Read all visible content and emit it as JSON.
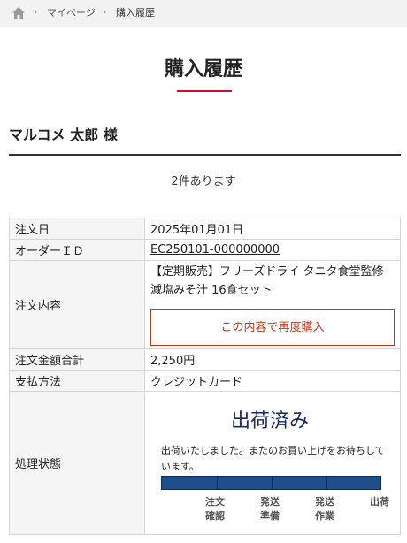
{
  "breadcrumb": {
    "home_icon": "home-icon",
    "separator_icon": "chevron-right-icon",
    "mypage": "マイページ",
    "current": "購入履歴"
  },
  "page": {
    "title": "購入履歴",
    "accent_color": "#c8102e"
  },
  "customer": {
    "name": "マルコメ 太郎 様"
  },
  "result": {
    "count_text": "2件あります"
  },
  "order": {
    "date_label": "注文日",
    "date_value": "2025年01月01日",
    "id_label": "オーダーＩＤ",
    "id_value": "EC250101-000000000",
    "content_label": "注文内容",
    "content_value": "【定期販売】フリーズドライ タニタ食堂監修減塩みそ汁 16食セット",
    "reorder_button": "この内容で再度購入",
    "total_label": "注文金額合計",
    "total_value": "2,250円",
    "payment_label": "支払方法",
    "payment_value": "クレジットカード",
    "status_label": "処理状態",
    "status_title": "出荷済み",
    "status_message": "出荷いたしました。またのお買い上げをお待ちしています。",
    "progress_fraction": 1.0,
    "steps": [
      "注文\n確認",
      "発送\n準備",
      "発送\n作業",
      "出荷"
    ]
  }
}
